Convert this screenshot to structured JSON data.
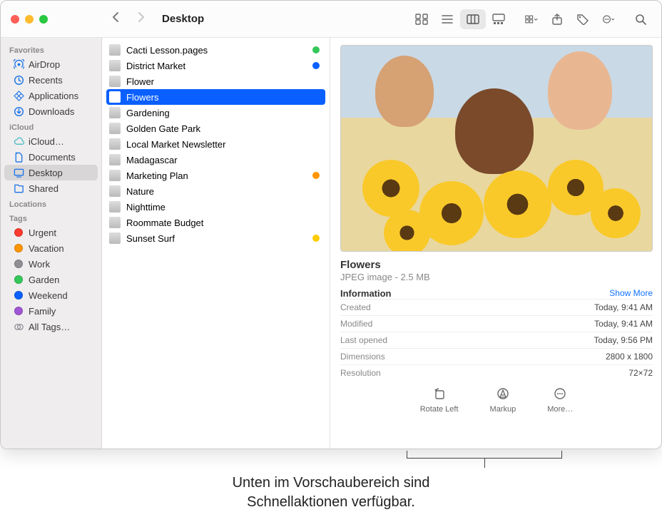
{
  "window_title": "Desktop",
  "sidebar": {
    "sections": [
      {
        "header": "Favorites",
        "items": [
          {
            "label": "AirDrop",
            "icon": "airdrop",
            "color": "blue"
          },
          {
            "label": "Recents",
            "icon": "clock",
            "color": "blue"
          },
          {
            "label": "Applications",
            "icon": "apps",
            "color": "blue"
          },
          {
            "label": "Downloads",
            "icon": "download",
            "color": "blue"
          }
        ]
      },
      {
        "header": "iCloud",
        "items": [
          {
            "label": "iCloud…",
            "icon": "cloud",
            "color": "teal"
          },
          {
            "label": "Documents",
            "icon": "doc",
            "color": "blue"
          },
          {
            "label": "Desktop",
            "icon": "desktop",
            "color": "blue",
            "selected": true
          },
          {
            "label": "Shared",
            "icon": "shared",
            "color": "blue"
          }
        ]
      },
      {
        "header": "Locations",
        "items": []
      },
      {
        "header": "Tags",
        "items": [
          {
            "label": "Urgent",
            "dot": "#ff3b30"
          },
          {
            "label": "Vacation",
            "dot": "#ff9500"
          },
          {
            "label": "Work",
            "dot": "#8e8e93"
          },
          {
            "label": "Garden",
            "dot": "#34c759"
          },
          {
            "label": "Weekend",
            "dot": "#0a60ff"
          },
          {
            "label": "Family",
            "dot": "#a055d5"
          },
          {
            "label": "All Tags…",
            "icon": "alltags"
          }
        ]
      }
    ]
  },
  "files": [
    {
      "name": "Cacti Lesson.pages",
      "tag": "#34c759"
    },
    {
      "name": "District Market",
      "tag": "#0a60ff"
    },
    {
      "name": "Flower"
    },
    {
      "name": "Flowers",
      "selected": true
    },
    {
      "name": "Gardening"
    },
    {
      "name": "Golden Gate Park"
    },
    {
      "name": "Local Market Newsletter"
    },
    {
      "name": "Madagascar"
    },
    {
      "name": "Marketing Plan",
      "tag": "#ff9500"
    },
    {
      "name": "Nature"
    },
    {
      "name": "Nighttime"
    },
    {
      "name": "Roommate Budget"
    },
    {
      "name": "Sunset Surf",
      "tag": "#ffcc00"
    }
  ],
  "preview": {
    "name": "Flowers",
    "type": "JPEG image - 2.5 MB",
    "info_header": "Information",
    "show_more": "Show More",
    "rows": [
      {
        "k": "Created",
        "v": "Today, 9:41 AM"
      },
      {
        "k": "Modified",
        "v": "Today, 9:41 AM"
      },
      {
        "k": "Last opened",
        "v": "Today, 9:56 PM"
      },
      {
        "k": "Dimensions",
        "v": "2800 x 1800"
      },
      {
        "k": "Resolution",
        "v": "72×72"
      }
    ],
    "quick_actions": [
      {
        "label": "Rotate Left",
        "icon": "rotate"
      },
      {
        "label": "Markup",
        "icon": "markup"
      },
      {
        "label": "More…",
        "icon": "more"
      }
    ]
  },
  "callout": {
    "line1": "Unten im Vorschaubereich sind",
    "line2": "Schnellaktionen verfügbar."
  }
}
